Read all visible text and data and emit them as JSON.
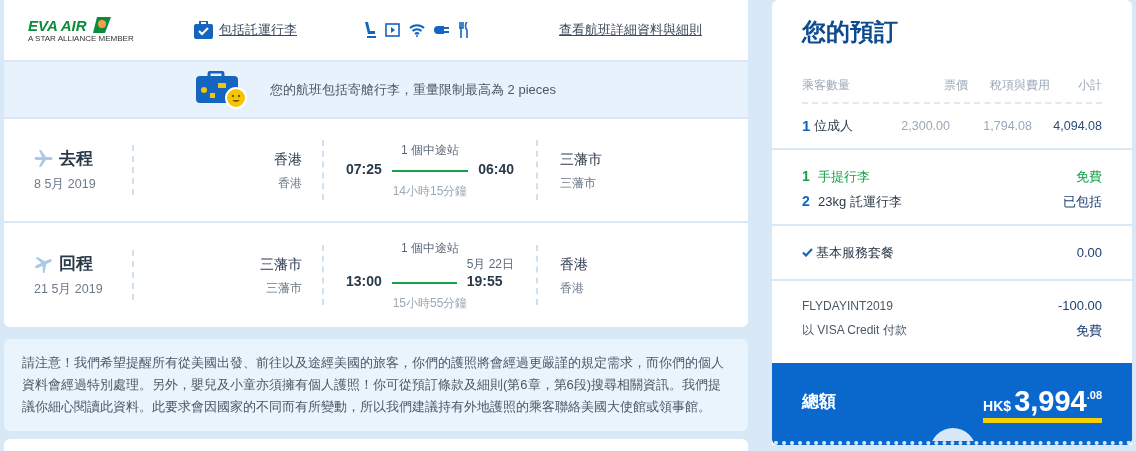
{
  "header": {
    "logo": {
      "name": "EVA AIR",
      "tagline": "A STAR ALLIANCE MEMBER"
    },
    "baggage_link": "包括託運行李",
    "details_link": "查看航班詳細資料與細則"
  },
  "baggage_notice": "您的航班包括寄艙行李，重量限制最高為 2 pieces",
  "flights": [
    {
      "label": "去程",
      "date": "8 5月 2019",
      "from_city": "香港",
      "from_airport": "香港",
      "stops": "1 個中途站",
      "depart": "07:25",
      "arrive": "06:40",
      "duration": "14小時15分鐘",
      "to_city": "三藩市",
      "to_airport": "三藩市"
    },
    {
      "label": "回程",
      "date": "21 5月 2019",
      "from_city": "三藩市",
      "from_airport": "三藩市",
      "stops": "1 個中途站",
      "depart": "13:00",
      "arrive_date": "5月 22日",
      "arrive": "19:55",
      "duration": "15小時55分鐘",
      "to_city": "香港",
      "to_airport": "香港"
    }
  ],
  "notice": "請注意！我們希望提醒所有從美國出發、前往以及途經美國的旅客，你們的護照將會經過更嚴謹的規定需求，而你們的個人資料會經過特別處理。另外，嬰兒及小童亦須擁有個人護照！你可從預訂條款及細則(第6章，第6段)搜尋相關資訊。我們提議你細心閱讀此資料。此要求會因國家的不同而有所變動，所以我們建議持有外地護照的乘客聯絡美國大使館或領事館。",
  "booking": {
    "title": "您的預訂",
    "columns": [
      "乘客數量",
      "票價",
      "稅項與費用",
      "小計"
    ],
    "passengers": [
      {
        "count": "1",
        "type": "位成人",
        "fare": "2,300.00",
        "taxes": "1,794.08",
        "subtotal": "4,094.08"
      }
    ],
    "baggage": [
      {
        "count": "1",
        "label": "手提行李",
        "price": "免費",
        "kind": "free"
      },
      {
        "count": "2",
        "label": "23kg 託運行李",
        "price": "已包括",
        "kind": "included"
      }
    ],
    "package": {
      "label": "基本服務套餐",
      "price": "0.00",
      "checked": true
    },
    "promo": {
      "code": "FLYDAYINT2019",
      "amount": "-100.00"
    },
    "payment": {
      "label": "以 VISA Credit 付款",
      "fee": "免費"
    },
    "total": {
      "label": "總額",
      "currency": "HK$",
      "whole": "3,994",
      "cents": ".08"
    }
  }
}
